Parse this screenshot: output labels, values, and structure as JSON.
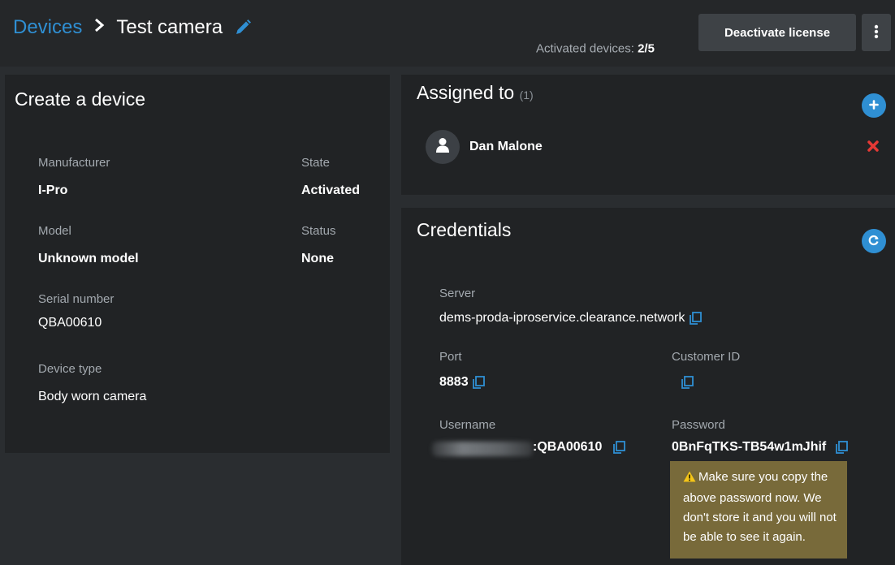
{
  "header": {
    "breadcrumb_root": "Devices",
    "device_name": "Test camera",
    "activated_label": "Activated devices:",
    "activated_value": "2/5",
    "deactivate_label": "Deactivate license"
  },
  "device_panel": {
    "title": "Create a device",
    "manufacturer_label": "Manufacturer",
    "manufacturer_value": "I-Pro",
    "state_label": "State",
    "state_value": "Activated",
    "model_label": "Model",
    "model_value": "Unknown model",
    "status_label": "Status",
    "status_value": "None",
    "serial_label": "Serial number",
    "serial_value": "QBA00610",
    "type_label": "Device type",
    "type_value": "Body worn camera"
  },
  "assigned": {
    "title": "Assigned to",
    "count": "(1)",
    "users": [
      {
        "name": "Dan Malone"
      }
    ]
  },
  "credentials": {
    "title": "Credentials",
    "server_label": "Server",
    "server_value": "dems-proda-iproservice.clearance.network",
    "port_label": "Port",
    "port_value": "8883",
    "customer_label": "Customer ID",
    "customer_value": "",
    "username_label": "Username",
    "username_suffix": ":QBA00610",
    "password_label": "Password",
    "password_value": "0BnFqTKS-TB54w1mJhif",
    "warning": "Make sure you copy the above password now. We don't store it and you will not be able to see it again."
  },
  "colors": {
    "accent": "#2f8fd3",
    "danger": "#e53935",
    "warning_bg": "#786a3a",
    "warning_icon": "#f5c518"
  },
  "icons": [
    "pencil-icon",
    "kebab-menu-icon",
    "add-icon",
    "user-icon",
    "remove-icon",
    "refresh-icon",
    "copy-icon",
    "warning-icon"
  ]
}
